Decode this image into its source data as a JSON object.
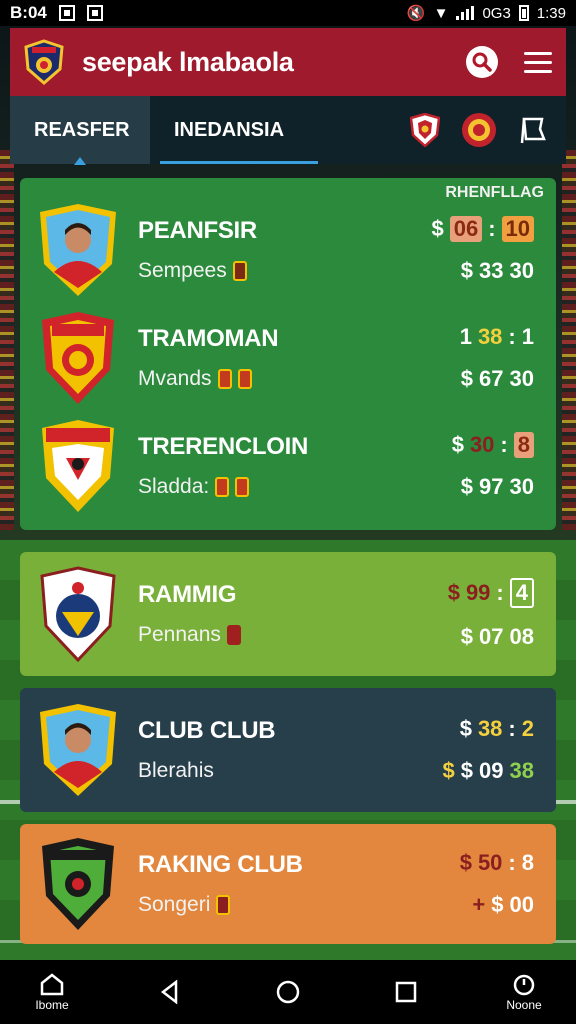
{
  "status_bar": {
    "time": "B:04",
    "network": "0G3",
    "clock": "1:39"
  },
  "app_bar": {
    "title": "seepak lmabaola",
    "search_icon": "search-icon",
    "menu_icon": "menu-icon"
  },
  "tabs": [
    {
      "label": "REASFER",
      "active": true
    },
    {
      "label": "INEDANSIA",
      "active": false
    }
  ],
  "main_card": {
    "header": "RHENFLLAG",
    "rows": [
      {
        "team": "PEANFSIR",
        "sub": "Sempees",
        "odds_top": [
          "$",
          "06",
          ":",
          "10"
        ],
        "odds_bottom": [
          "$",
          "33",
          "30"
        ]
      },
      {
        "team": "TRAMOMAN",
        "sub": "Mvands",
        "odds_top": [
          "1",
          "38",
          ":",
          "1"
        ],
        "odds_bottom": [
          "$",
          "67",
          "30"
        ]
      },
      {
        "team": "TRERENCLOIN",
        "sub": "Sladda:",
        "odds_top": [
          "$",
          "30",
          ":",
          "8"
        ],
        "odds_bottom": [
          "$",
          "97",
          "30"
        ]
      }
    ]
  },
  "cards": [
    {
      "team": "RAMMIG",
      "sub": "Pennans",
      "odds_top": [
        "$",
        "99",
        ":",
        "4"
      ],
      "odds_bottom": [
        "$",
        "07",
        "08"
      ]
    },
    {
      "team": "CLUB CLUB",
      "sub": "Blerahis",
      "odds_top": [
        "$",
        "38",
        ":",
        "2"
      ],
      "odds_bottom": [
        "$",
        "$",
        "09",
        "38"
      ]
    },
    {
      "team": "RAKING CLUB",
      "sub": "Songeri",
      "odds_top": [
        "$",
        "50",
        ":",
        "8"
      ],
      "odds_bottom": [
        "+",
        "$",
        "00"
      ]
    }
  ],
  "navbar": {
    "home_label": "Ibome",
    "right_label": "Noone"
  },
  "colors": {
    "app_bar": "#9e1a2c",
    "tabs": "#0f2129",
    "main_card": "#2b8a3b",
    "lime_card": "#79b03a",
    "navy_card": "#263f4b",
    "orange_card": "#e2873d"
  }
}
